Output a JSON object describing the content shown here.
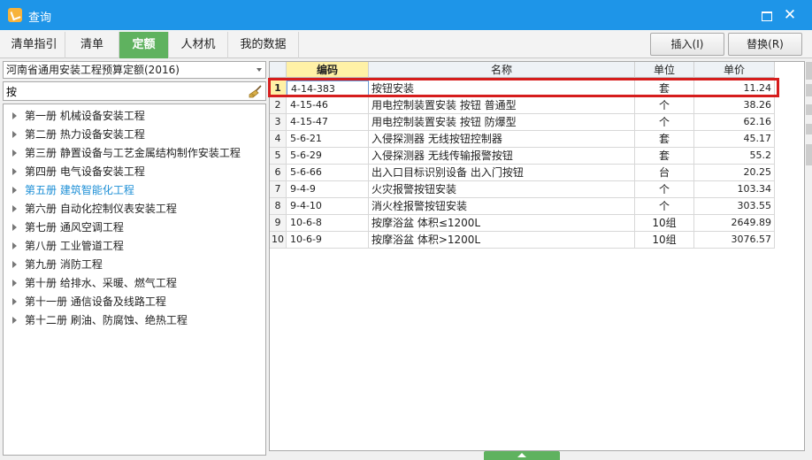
{
  "window": {
    "title": "查询"
  },
  "tabs": [
    {
      "label": "清单指引",
      "active": false
    },
    {
      "label": "清单",
      "active": false
    },
    {
      "label": "定额",
      "active": true
    },
    {
      "label": "人材机",
      "active": false
    },
    {
      "label": "我的数据",
      "active": false
    }
  ],
  "toolbar": {
    "insert_label": "插入(I)",
    "replace_label": "替换(R)"
  },
  "left": {
    "quota_library": "河南省通用安装工程预算定额(2016)",
    "search_value": "按",
    "tree": [
      {
        "label": "第一册 机械设备安装工程"
      },
      {
        "label": "第二册 热力设备安装工程"
      },
      {
        "label": "第三册 静置设备与工艺金属结构制作安装工程"
      },
      {
        "label": "第四册 电气设备安装工程"
      },
      {
        "label": "第五册 建筑智能化工程"
      },
      {
        "label": "第六册 自动化控制仪表安装工程"
      },
      {
        "label": "第七册 通风空调工程"
      },
      {
        "label": "第八册 工业管道工程"
      },
      {
        "label": "第九册 消防工程"
      },
      {
        "label": "第十册 给排水、采暖、燃气工程"
      },
      {
        "label": "第十一册 通信设备及线路工程"
      },
      {
        "label": "第十二册 刷油、防腐蚀、绝热工程"
      }
    ],
    "selected_index": 4
  },
  "grid": {
    "columns": {
      "code": "编码",
      "name": "名称",
      "unit": "单位",
      "price": "单价"
    },
    "rows": [
      {
        "num": "1",
        "code": "4-14-383",
        "name": "按钮安装",
        "unit": "套",
        "price": "11.24"
      },
      {
        "num": "2",
        "code": "4-15-46",
        "name": "用电控制装置安装 按钮 普通型",
        "unit": "个",
        "price": "38.26"
      },
      {
        "num": "3",
        "code": "4-15-47",
        "name": "用电控制装置安装 按钮 防爆型",
        "unit": "个",
        "price": "62.16"
      },
      {
        "num": "4",
        "code": "5-6-21",
        "name": "入侵探测器 无线按钮控制器",
        "unit": "套",
        "price": "45.17"
      },
      {
        "num": "5",
        "code": "5-6-29",
        "name": "入侵探测器 无线传输报警按钮",
        "unit": "套",
        "price": "55.2"
      },
      {
        "num": "6",
        "code": "5-6-66",
        "name": "出入口目标识别设备 出入门按钮",
        "unit": "台",
        "price": "20.25"
      },
      {
        "num": "7",
        "code": "9-4-9",
        "name": "火灾报警按钮安装",
        "unit": "个",
        "price": "103.34"
      },
      {
        "num": "8",
        "code": "9-4-10",
        "name": "消火栓报警按钮安装",
        "unit": "个",
        "price": "303.55"
      },
      {
        "num": "9",
        "code": "10-6-8",
        "name": "按摩浴盆 体积≤1200L",
        "unit": "10组",
        "price": "2649.89"
      },
      {
        "num": "10",
        "code": "10-6-9",
        "name": "按摩浴盆 体积>1200L",
        "unit": "10组",
        "price": "3076.57"
      }
    ],
    "active_row": 0
  },
  "colors": {
    "titlebar": "#1e95e8",
    "active_tab": "#5fb25f",
    "highlight": "#d61d1d",
    "selected_tree": "#1d8fd6",
    "code_header": "#fff1a6"
  }
}
